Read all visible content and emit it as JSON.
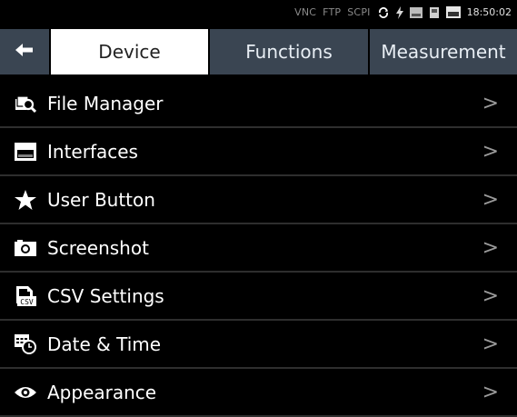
{
  "status": {
    "vnc": "VNC",
    "ftp": "FTP",
    "scpi": "SCPI",
    "clock": "18:50:02",
    "icons": [
      "sync-icon",
      "flash-icon",
      "sd-card-icon",
      "usb-icon",
      "network-icon"
    ]
  },
  "tabs": {
    "back_icon": "back-arrow-icon",
    "items": [
      {
        "label": "Device",
        "active": true
      },
      {
        "label": "Functions",
        "active": false
      },
      {
        "label": "Measurement",
        "active": false
      }
    ]
  },
  "menu": [
    {
      "label": "File Manager",
      "icon": "file-manager-icon",
      "chevron": ">"
    },
    {
      "label": "Interfaces",
      "icon": "interfaces-icon",
      "chevron": ">"
    },
    {
      "label": "User Button",
      "icon": "star-icon",
      "chevron": ">"
    },
    {
      "label": "Screenshot",
      "icon": "camera-icon",
      "chevron": ">"
    },
    {
      "label": "CSV Settings",
      "icon": "csv-icon",
      "chevron": ">"
    },
    {
      "label": "Date & Time",
      "icon": "date-time-icon",
      "chevron": ">"
    },
    {
      "label": "Appearance",
      "icon": "eye-icon",
      "chevron": ">"
    }
  ],
  "colors": {
    "background": "#000000",
    "tab_inactive": "#3a4552",
    "tab_active": "#ffffff",
    "chevron": "#9a9a9a"
  }
}
